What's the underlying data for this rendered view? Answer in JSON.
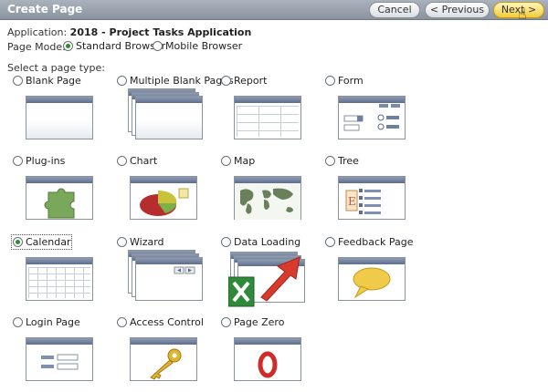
{
  "header": {
    "title": "Create Page",
    "cancel": "Cancel",
    "previous": "< Previous",
    "next": "Next >"
  },
  "app": {
    "label": "Application:",
    "value": "2018 - Project Tasks Application"
  },
  "mode": {
    "label": "Page Mode:",
    "standard": "Standard Browser",
    "mobile": "Mobile Browser",
    "selected": "Standard Browser"
  },
  "select_label": "Select a page type:",
  "page_types": {
    "blank": "Blank Page",
    "multiple": "Multiple Blank Pages",
    "report": "Report",
    "form": "Form",
    "plugins": "Plug-ins",
    "chart": "Chart",
    "map": "Map",
    "tree": "Tree",
    "calendar": "Calendar",
    "wizard": "Wizard",
    "dataloading": "Data Loading",
    "feedback": "Feedback Page",
    "login": "Login Page",
    "access": "Access Control",
    "zero": "Page Zero",
    "selected": "Calendar"
  },
  "icons": {
    "blank": "blank-page-icon",
    "multiple": "multiple-pages-icon",
    "report": "report-table-icon",
    "form": "form-icon",
    "plugins": "puzzle-piece-icon",
    "chart": "pie-chart-icon",
    "map": "world-map-icon",
    "tree": "tree-icon",
    "calendar": "calendar-icon",
    "wizard": "wizard-icon",
    "dataloading": "excel-upload-icon",
    "feedback": "speech-bubble-icon",
    "login": "login-form-icon",
    "access": "key-icon",
    "zero": "page-zero-icon"
  },
  "colors": {
    "header": "#8a949f",
    "next_button": "#f3cc3a",
    "selected_radio": "#2e8b2e"
  }
}
